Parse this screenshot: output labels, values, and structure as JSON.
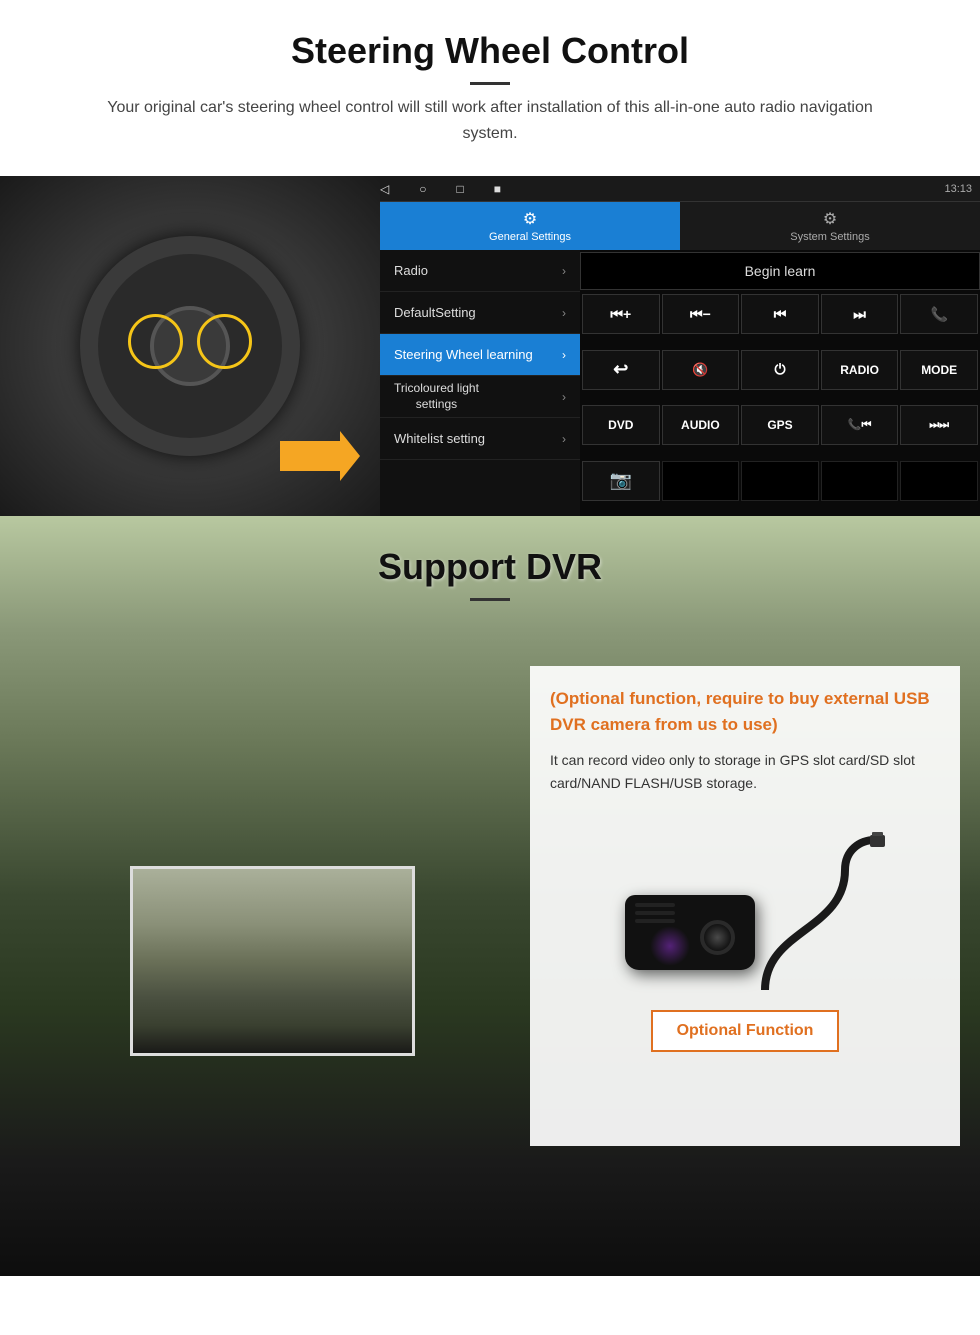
{
  "steering_section": {
    "title": "Steering Wheel Control",
    "subtitle": "Your original car's steering wheel control will still work after installation of this all-in-one auto radio navigation system.",
    "android_ui": {
      "status_bar": {
        "time": "13:13",
        "signal_icon": "▼",
        "wifi_icon": "▾",
        "battery_icon": "▮"
      },
      "nav_buttons": [
        "◁",
        "○",
        "□",
        "■"
      ],
      "tabs": [
        {
          "icon": "⚙",
          "label": "General Settings",
          "active": true
        },
        {
          "icon": "⚙",
          "label": "System Settings",
          "active": false
        }
      ],
      "menu_items": [
        {
          "label": "Radio",
          "active": false
        },
        {
          "label": "DefaultSetting",
          "active": false
        },
        {
          "label": "Steering Wheel learning",
          "active": true
        },
        {
          "label": "Tricoloured light settings",
          "active": false
        },
        {
          "label": "Whitelist setting",
          "active": false
        }
      ],
      "begin_learn_btn": "Begin learn",
      "control_buttons": [
        "⏮+",
        "⏮−",
        "⏮⏮",
        "⏭⏭",
        "📞",
        "↩",
        "🔇",
        "⏻",
        "RADIO",
        "MODE",
        "DVD",
        "AUDIO",
        "GPS",
        "📞⏮",
        "⏭",
        "📷",
        "",
        "",
        "",
        ""
      ]
    }
  },
  "dvr_section": {
    "title": "Support DVR",
    "optional_title": "(Optional function, require to buy external USB DVR camera from us to use)",
    "description": "It can record video only to storage in GPS slot card/SD slot card/NAND FLASH/USB storage.",
    "optional_btn_label": "Optional Function"
  }
}
